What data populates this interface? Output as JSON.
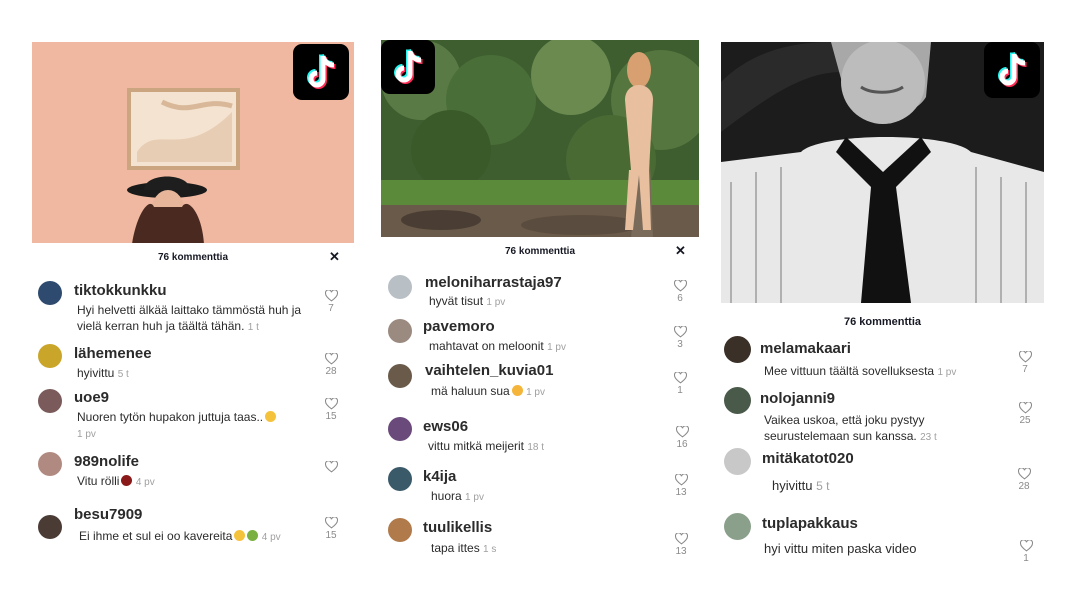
{
  "panels": [
    {
      "count_label": "76 kommenttia",
      "close_label": "✕",
      "comments": [
        {
          "user": "tiktokkunkku",
          "text": "Hyi helvetti älkää laittako tämmöstä huh ja vielä kerran huh ja täältä tähän.",
          "time": "1 t",
          "likes": "7",
          "avatar": "#2e4a6e"
        },
        {
          "user": "lähemenee",
          "text": "hyivittu",
          "time": "5 t",
          "likes": "28",
          "avatar": "#c9a52a"
        },
        {
          "user": "uoe9",
          "text": "Nuoren tytön hupakon juttuja taas..",
          "time": "1 pv",
          "likes": "15",
          "avatar": "#7a5a5a"
        },
        {
          "user": "989nolife",
          "text": "Vitu rölli",
          "time": "4 pv",
          "likes": "",
          "avatar": "#b08a80"
        },
        {
          "user": "besu7909",
          "text": "Ei ihme et sul ei oo kavereita",
          "time": "4 pv",
          "likes": "15",
          "avatar": "#4a3b35"
        }
      ]
    },
    {
      "count_label": "76 kommenttia",
      "close_label": "✕",
      "comments": [
        {
          "user": "meloniharrastaja97",
          "text": "hyvät tisut",
          "time": "1 pv",
          "likes": "6",
          "avatar": "#b8bfc5"
        },
        {
          "user": "pavemoro",
          "text": "mahtavat on meloonit",
          "time": "1 pv",
          "likes": "3",
          "avatar": "#9a8a80"
        },
        {
          "user": "vaihtelen_kuvia01",
          "text": "mä haluun sua",
          "time": "1 pv",
          "likes": "1",
          "avatar": "#6a5a4a"
        },
        {
          "user": "ews06",
          "text": "vittu mitkä meijerit",
          "time": "18 t",
          "likes": "16",
          "avatar": "#6a4a7a"
        },
        {
          "user": "k4ija",
          "text": "huora",
          "time": "1 pv",
          "likes": "13",
          "avatar": "#3a5a6a"
        },
        {
          "user": "tuulikellis",
          "text": "tapa ittes",
          "time": "1 s",
          "likes": "13",
          "avatar": "#b07a4a"
        }
      ]
    },
    {
      "count_label": "76 kommenttia",
      "comments": [
        {
          "user": "melamakaari",
          "text": "Mee vittuun täältä sovelluksesta",
          "time": "1 pv",
          "likes": "7",
          "avatar": "#3a3028"
        },
        {
          "user": "nolojanni9",
          "text": "Vaikea uskoa, että joku pystyy seurustelemaan sun kanssa.",
          "time": "23 t",
          "likes": "25",
          "avatar": "#4a5a4a"
        },
        {
          "user": "mitäkatot020",
          "text": "hyivittu",
          "time": "5 t",
          "likes": "28",
          "avatar": "#c8c8c8"
        },
        {
          "user": "tuplapakkaus",
          "text": "hyi vittu miten paska video",
          "time": "",
          "likes": "1",
          "avatar": "#8aa08a"
        }
      ]
    }
  ]
}
